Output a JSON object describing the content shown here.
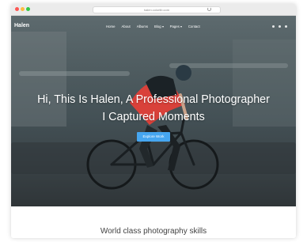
{
  "browser": {
    "url": "halen.colorlib.com"
  },
  "nav": {
    "logo": "Halen",
    "items": [
      {
        "label": "Home",
        "dropdown": false
      },
      {
        "label": "About",
        "dropdown": false
      },
      {
        "label": "Albums",
        "dropdown": false
      },
      {
        "label": "Blog",
        "dropdown": true
      },
      {
        "label": "Pages",
        "dropdown": true
      },
      {
        "label": "Contact",
        "dropdown": false
      }
    ],
    "social_icons": [
      "facebook-icon",
      "twitter-icon",
      "instagram-icon"
    ]
  },
  "hero": {
    "headline_line1": "Hi, This Is Halen, A Professional Photographer",
    "headline_line2": "I Captured Moments",
    "cta_label": "Explore Work"
  },
  "section": {
    "heading": "World class photography skills"
  },
  "colors": {
    "accent": "#46a6f0",
    "jersey": "#d9413a",
    "helmet": "#2a3a44"
  }
}
